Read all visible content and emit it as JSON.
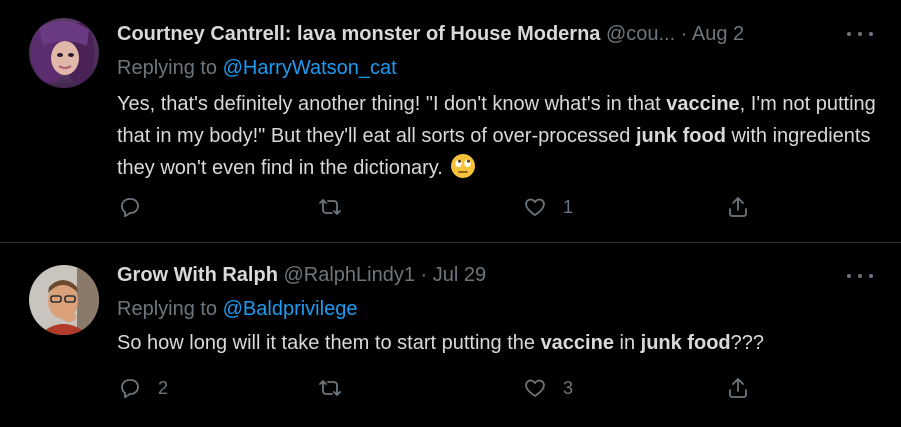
{
  "colors": {
    "background": "#000000",
    "divider": "#2f3336",
    "text": "#d9d9d9",
    "muted": "#6e767d",
    "link": "#1d9bf0"
  },
  "tweets": [
    {
      "display_name": "Courtney Cantrell: lava monster of House Moderna",
      "handle": "@cou...",
      "separator": "·",
      "date": "Aug 2",
      "replying_prefix": "Replying to",
      "replying_to": "@HarryWatson_cat",
      "body": {
        "t1": "Yes, that's definitely another thing! \"I don't know what's in that ",
        "b1": "vaccine",
        "t2": ", I'm not putting that in my body!\" But they'll eat all sorts of over-processed ",
        "b2": "junk food",
        "t3": " with ingredients they won't even find in the dictionary. "
      },
      "emoji_icon": "rolling-eyes-emoji",
      "replies": "",
      "retweets": "",
      "likes": "1"
    },
    {
      "display_name": "Grow With Ralph",
      "handle": "@RalphLindy1",
      "separator": "·",
      "date": "Jul 29",
      "replying_prefix": "Replying to",
      "replying_to": "@Baldprivilege",
      "body": {
        "t1": "So how long will it take them to start putting the ",
        "b1": "vaccine",
        "t2": " in ",
        "b2": "junk food",
        "t3": "???"
      },
      "replies": "2",
      "retweets": "",
      "likes": "3"
    }
  ],
  "icons": {
    "more": "more-dots-icon",
    "reply": "reply-bubble-icon",
    "retweet": "retweet-icon",
    "like": "heart-icon",
    "share": "share-icon"
  }
}
